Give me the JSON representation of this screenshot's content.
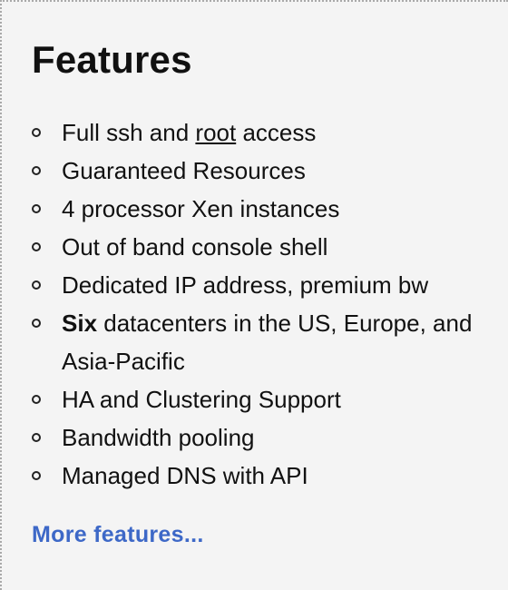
{
  "panel": {
    "title": "Features",
    "features": [
      {
        "prefix": "Full ssh and ",
        "link": "root",
        "suffix": " access"
      },
      {
        "text": "Guaranteed Resources"
      },
      {
        "text": "4 processor Xen instances"
      },
      {
        "text": "Out of band console shell"
      },
      {
        "text": "Dedicated IP address, premium bw"
      },
      {
        "bold": "Six",
        "text": " datacenters in the US, Europe, and Asia-Pacific"
      },
      {
        "text": "HA and Clustering Support"
      },
      {
        "text": "Bandwidth pooling"
      },
      {
        "text": "Managed DNS with API"
      }
    ],
    "more_link": "More features..."
  },
  "colors": {
    "background": "#f4f4f4",
    "text": "#111111",
    "link": "#3d68c7",
    "border": "#a9a9a9"
  },
  "icons": {
    "bullet": "hollow-circle-bullet-icon"
  }
}
